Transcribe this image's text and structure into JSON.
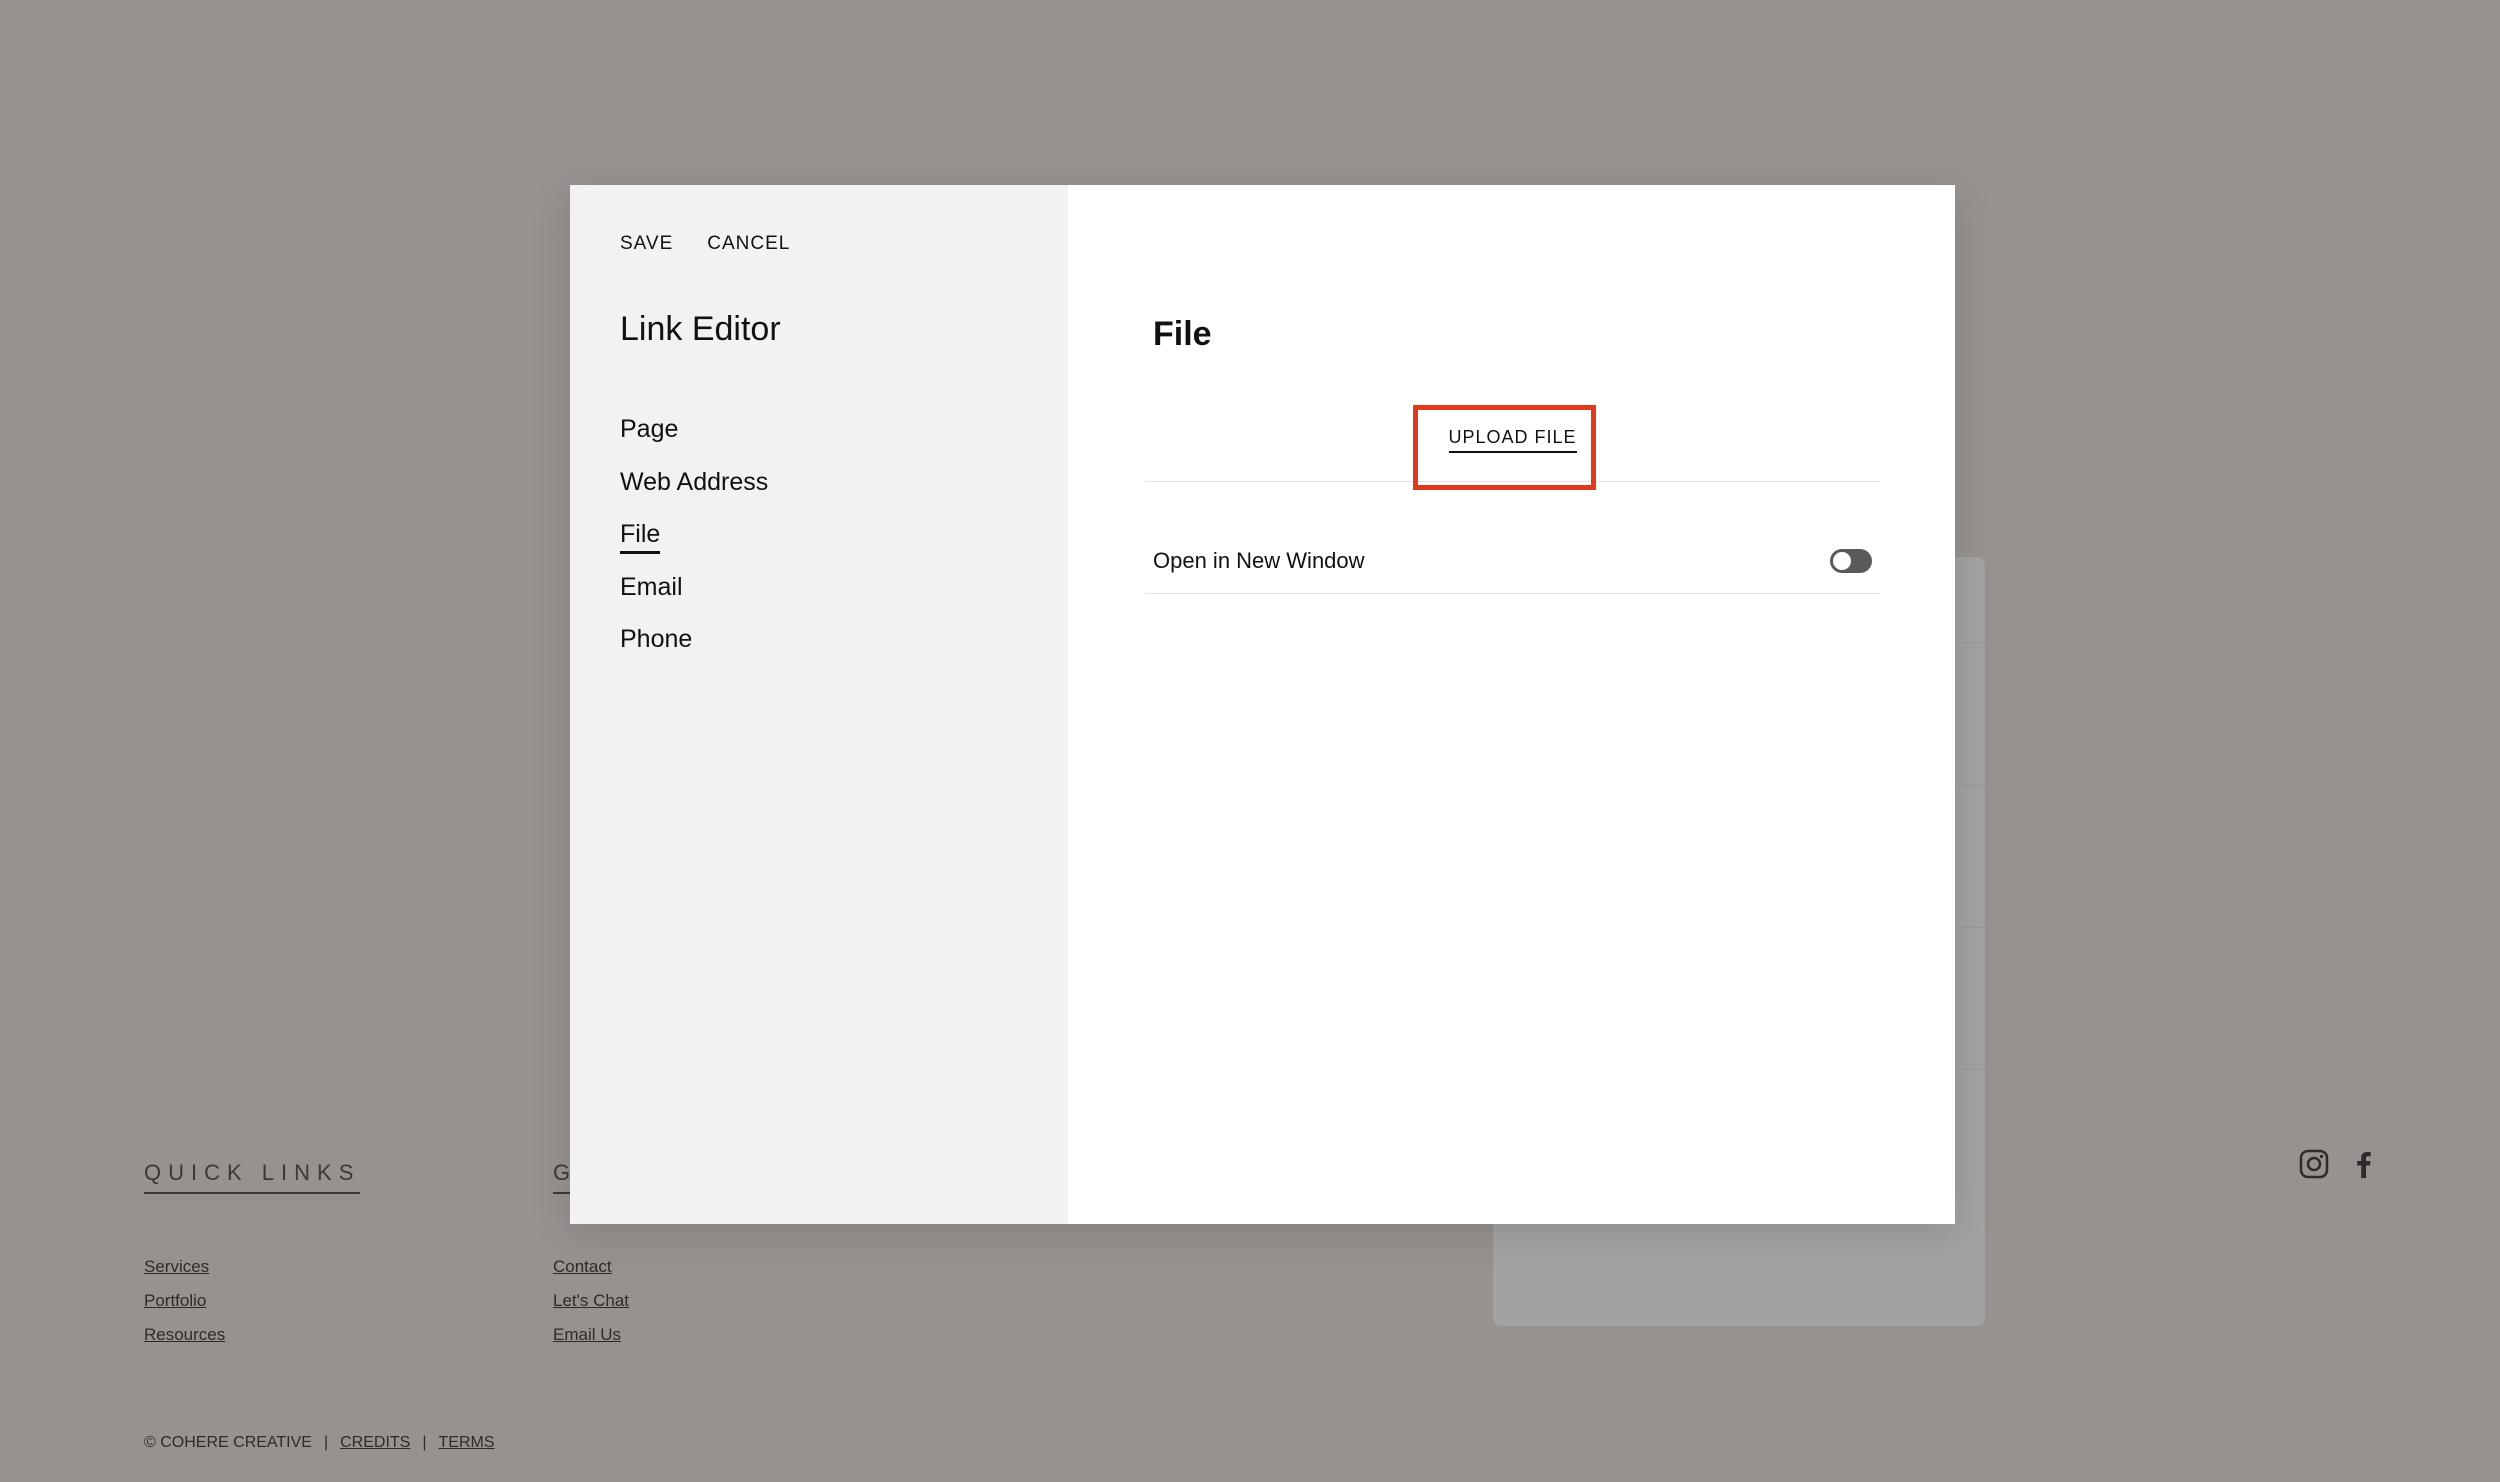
{
  "modal": {
    "save_label": "SAVE",
    "cancel_label": "CANCEL",
    "title": "Link Editor",
    "nav_items": [
      {
        "label": "Page",
        "active": false
      },
      {
        "label": "Web Address",
        "active": false
      },
      {
        "label": "File",
        "active": true
      },
      {
        "label": "Email",
        "active": false
      },
      {
        "label": "Phone",
        "active": false
      }
    ],
    "panel_title": "File",
    "upload_label": "UPLOAD FILE",
    "option_label": "Open in New Window",
    "option_value": false
  },
  "footer": {
    "quick_links_heading": "QUICK LINKS",
    "second_heading": "G",
    "quick_links": [
      "Services",
      "Portfolio",
      "Resources"
    ],
    "contact_links": [
      "Contact",
      "Let's Chat",
      "Email Us"
    ],
    "copyright": "© COHERE CREATIVE",
    "separator": "|",
    "credits_label": "CREDITS",
    "terms_label": "TERMS"
  },
  "icons": {
    "social": [
      "instagram-icon",
      "facebook-icon"
    ]
  },
  "colors": {
    "overlay": "#97928f",
    "highlight": "#e03a1e",
    "toggle_off": "#5a5a5a"
  }
}
